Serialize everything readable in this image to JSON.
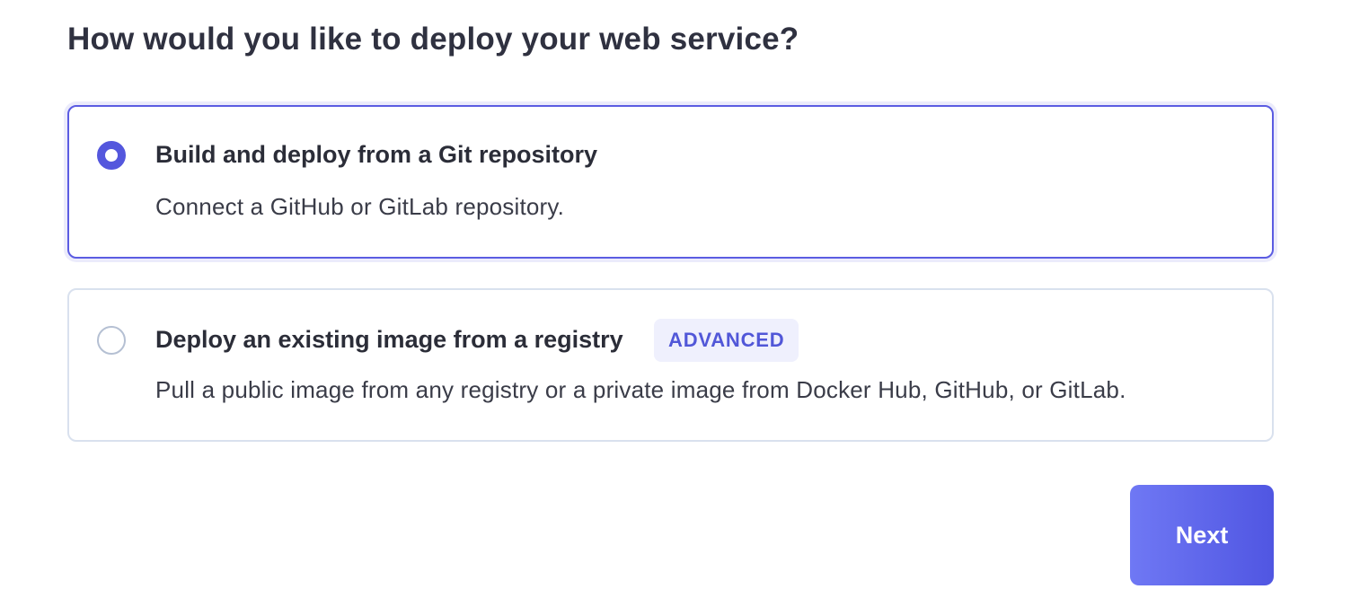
{
  "page": {
    "title": "How would you like to deploy your web service?"
  },
  "options": [
    {
      "title": "Build and deploy from a Git repository",
      "description": "Connect a GitHub or GitLab repository.",
      "selected": true
    },
    {
      "title": "Deploy an existing image from a registry",
      "badge": "ADVANCED",
      "description": "Pull a public image from any registry or a private image from Docker Hub, GitHub, or GitLab.",
      "selected": false
    }
  ],
  "footer": {
    "next_label": "Next"
  },
  "colors": {
    "accent": "#5457dd",
    "selected_border": "#5b5ce2",
    "unselected_border": "#d9e1ee",
    "badge_bg": "#eff0fd",
    "badge_text": "#5157d8",
    "button_gradient_start": "#6f78f4",
    "button_gradient_end": "#5056e2"
  }
}
